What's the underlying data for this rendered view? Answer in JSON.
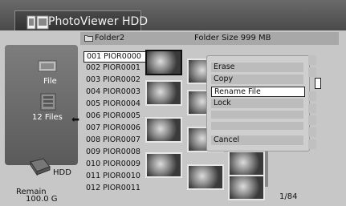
{
  "title": "PhotoViewer HDD",
  "header": {
    "folder": "Folder2",
    "folder_size": "Folder Size 999 MB"
  },
  "left_panel": {
    "file_label": "File",
    "files_count": "12 Files",
    "drive": "HDD",
    "remain_label": "Remain",
    "remain_value": "100.0 G"
  },
  "files": [
    {
      "id": "001",
      "name": "PIOR0000"
    },
    {
      "id": "002",
      "name": "PIOR0001"
    },
    {
      "id": "003",
      "name": "PIOR0002"
    },
    {
      "id": "004",
      "name": "PIOR0003"
    },
    {
      "id": "005",
      "name": "PIOR0004"
    },
    {
      "id": "006",
      "name": "PIOR0005"
    },
    {
      "id": "007",
      "name": "PIOR0006"
    },
    {
      "id": "008",
      "name": "PIOR0007"
    },
    {
      "id": "009",
      "name": "PIOR0008"
    },
    {
      "id": "010",
      "name": "PIOR0009"
    },
    {
      "id": "011",
      "name": "PIOR0010"
    },
    {
      "id": "012",
      "name": "PIOR0011"
    }
  ],
  "menu": {
    "erase": "Erase",
    "copy": "Copy",
    "rename": "Rename File",
    "lock": "Lock",
    "cancel": "Cancel"
  },
  "page": "1/84"
}
